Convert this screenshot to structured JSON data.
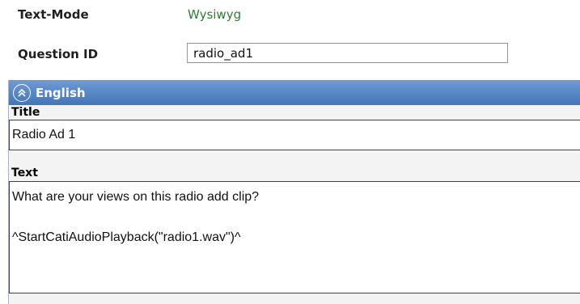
{
  "text_mode": {
    "label": "Text-Mode",
    "value": "Wysiwyg"
  },
  "question_id": {
    "label": "Question ID",
    "value": "radio_ad1"
  },
  "language_panel": {
    "header": "English",
    "title": {
      "label": "Title",
      "value": "Radio Ad 1"
    },
    "text": {
      "label": "Text",
      "value": "What are your views on this radio add clip?\n\n^StartCatiAudioPlayback(\"radio1.wav\")^"
    }
  },
  "colors": {
    "link": "#2e7d32",
    "panel_header": "#4f7fc0",
    "panel_background": "#f3f3f3"
  },
  "icons": {
    "collapse": "collapse-up-icon"
  }
}
